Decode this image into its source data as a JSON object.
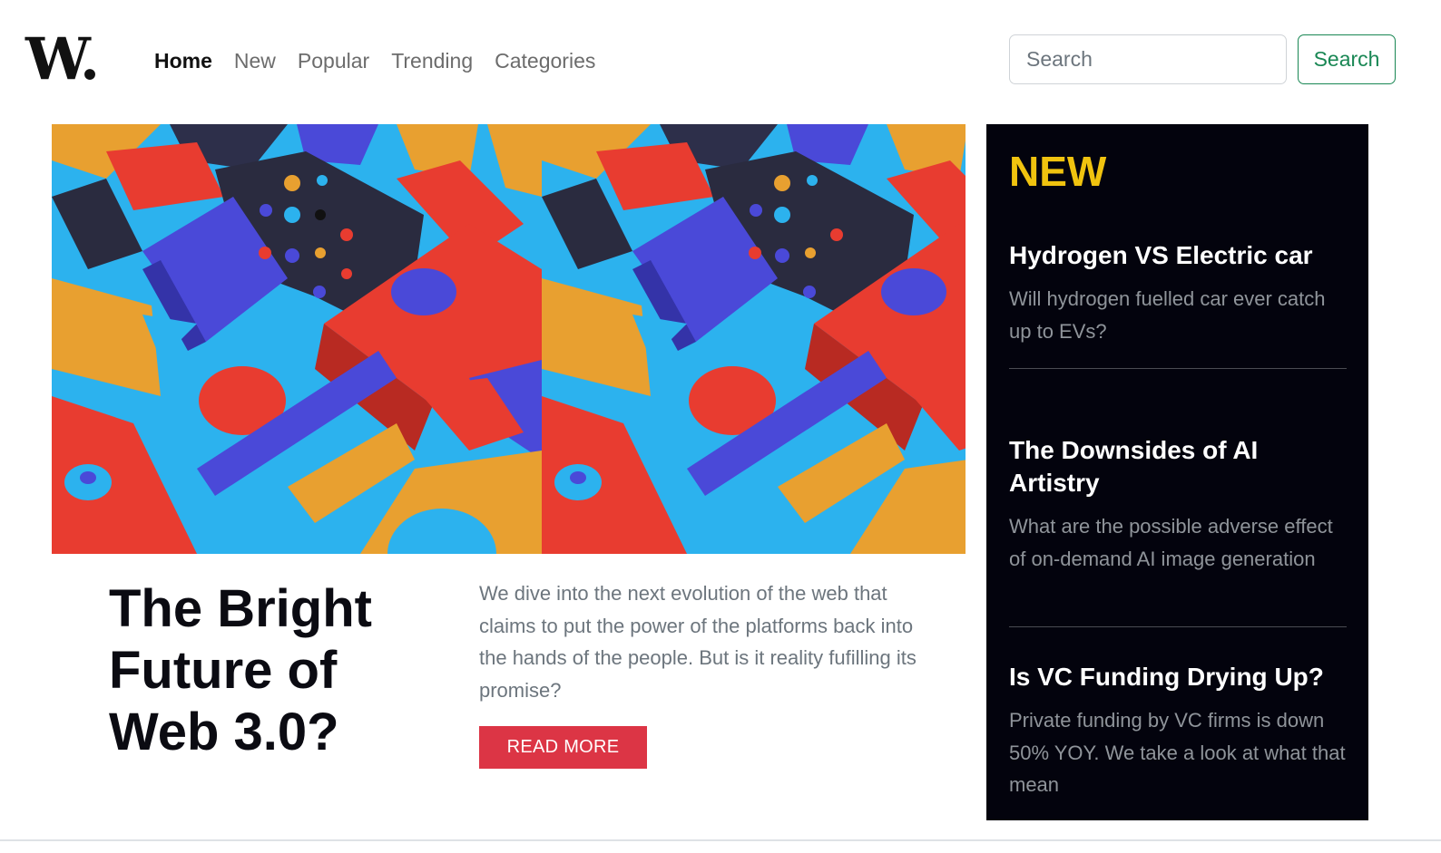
{
  "brand": {
    "logo": "W."
  },
  "nav": {
    "items": [
      {
        "label": "Home",
        "active": true
      },
      {
        "label": "New",
        "active": false
      },
      {
        "label": "Popular",
        "active": false
      },
      {
        "label": "Trending",
        "active": false
      },
      {
        "label": "Categories",
        "active": false
      }
    ]
  },
  "search": {
    "placeholder": "Search",
    "value": "",
    "button_label": "Search"
  },
  "hero": {
    "image_icon": "abstract-3d-shapes-image",
    "title": "The Bright Future of Web 3.0?",
    "description": "We dive into the next evolution of the web that claims to put the power of the platforms back into the hands of the people. But is it reality fufilling its promise?",
    "button_label": "READ MORE"
  },
  "sidebar": {
    "heading": "NEW",
    "articles": [
      {
        "title": "Hydrogen VS Electric car",
        "summary": "Will hydrogen fuelled car ever catch up to EVs?"
      },
      {
        "title": "The Downsides of AI Artistry",
        "summary": "What are the possible adverse effect of on-demand AI image generation"
      },
      {
        "title": "Is VC Funding Drying Up?",
        "summary": "Private funding by VC firms is down 50% YOY. We take a look at what that mean"
      }
    ]
  },
  "colors": {
    "accent_green": "#198754",
    "accent_red": "#dc3545",
    "sidebar_bg": "#03030d",
    "sidebar_heading": "#f0c30f"
  }
}
